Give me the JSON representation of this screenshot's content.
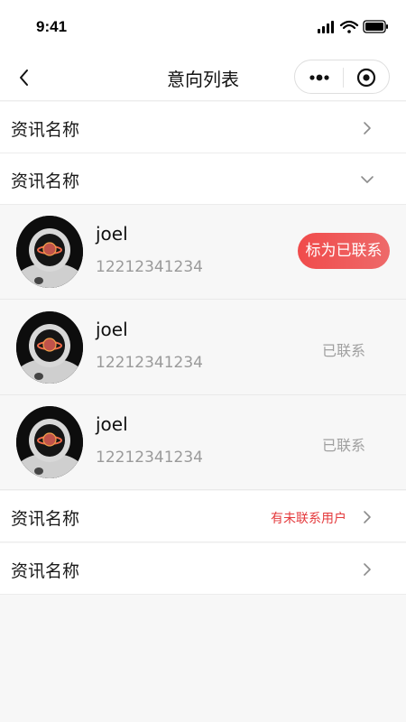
{
  "status_bar": {
    "time": "9:41"
  },
  "nav": {
    "title": "意向列表"
  },
  "rows": [
    {
      "title": "资讯名称",
      "arrow": "chevron-right"
    },
    {
      "title": "资讯名称",
      "arrow": "chevron-down",
      "expanded": true
    },
    {
      "title": "资讯名称",
      "note": "有未联系用户",
      "arrow": "chevron-right"
    },
    {
      "title": "资讯名称",
      "arrow": "chevron-right"
    }
  ],
  "contacts": [
    {
      "name": "joel",
      "phone": "12212341234",
      "action": "标为已联系",
      "contacted": false
    },
    {
      "name": "joel",
      "phone": "12212341234",
      "status": "已联系",
      "contacted": true
    },
    {
      "name": "joel",
      "phone": "12212341234",
      "status": "已联系",
      "contacted": true
    }
  ],
  "colors": {
    "accent": "#f04b4b",
    "note_red": "#e4393c",
    "muted": "#9a9a9a"
  }
}
